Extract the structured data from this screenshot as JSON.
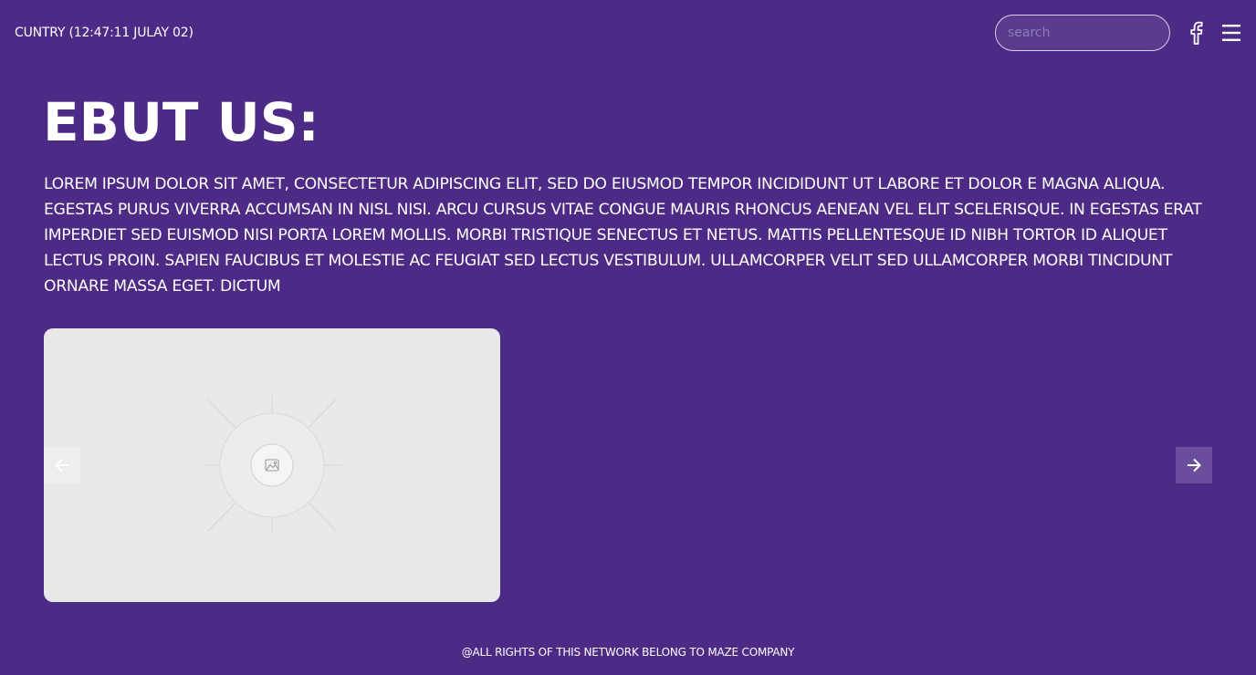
{
  "header": {
    "location_time": "CUNTRY (12:47:11 JULAY 02)",
    "search_placeholder": "search",
    "icons": [
      "facebook-icon",
      "menu-icon"
    ]
  },
  "main": {
    "title": "EBUT US:",
    "body": "LOREM IPSUM DOLOR SIT AMET, CONSECTETUR ADIPISCING ELIT, SED DO EIUSMOD TEMPOR INCIDIDUNT UT LABORE ET DOLOR E MAGNA ALIQUA. EGESTAS PURUS VIVERRA ACCUMSAN IN NISL NISI. ARCU CURSUS VITAE CONGUE MAURIS RHONCUS AENEAN VEL ELIT SCELERISQUE. IN EGESTAS ERAT IMPERDIET SED EUISMOD NISI PORTA LOREM MOLLIS. MORBI TRISTIQUE SENECTUS ET NETUS. MATTIS PELLENTESQUE ID NIBH TORTOR ID ALIQUET LECTUS PROIN. SAPIEN FAUCIBUS ET MOLESTIE AC FEUGIAT SED LECTUS VESTIBULUM. ULLAMCORPER VELIT SED ULLAMCORPER MORBI TINCIDUNT ORNARE MASSA EGET. DICTUM"
  },
  "carousel": {
    "icons": [
      "arrow-left-icon",
      "arrow-right-icon",
      "image-placeholder-icon"
    ]
  },
  "footer": {
    "text": "@ALL RIGHTS OF THIS NETWORK BELONG TO MAZE COMPANY"
  },
  "colors": {
    "background": "#4e2a87",
    "text": "#ffffff",
    "card": "#e9e9e9",
    "next_button": "#6a4d9d"
  }
}
